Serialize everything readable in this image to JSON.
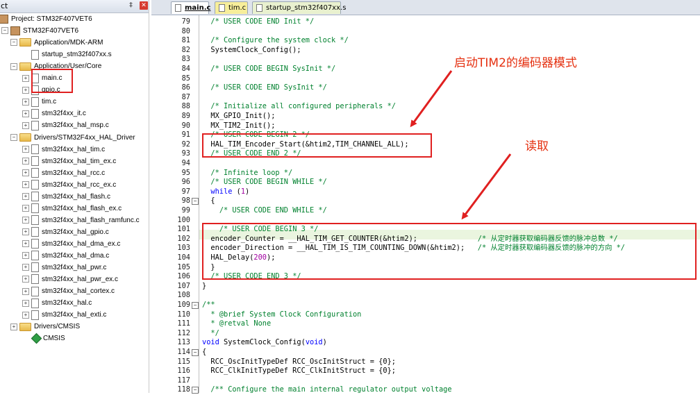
{
  "panel": {
    "title": "ct",
    "pin_glyph": "‡",
    "close_glyph": "✕",
    "tree": [
      {
        "label": "Project: STM32F407VET6",
        "icon": "project-icon",
        "expander": ""
      },
      {
        "label": "STM32F407VET6",
        "icon": "target-icon",
        "expander": "−"
      },
      {
        "label": "Application/MDK-ARM",
        "icon": "folder-icon",
        "expander": "−"
      },
      {
        "label": "startup_stm32f407xx.s",
        "icon": "file-icon",
        "expander": ""
      },
      {
        "label": "Application/User/Core",
        "icon": "folder-icon",
        "expander": "−"
      },
      {
        "label": "main.c",
        "icon": "file-icon",
        "expander": "+"
      },
      {
        "label": "gpio.c",
        "icon": "file-icon",
        "expander": "+"
      },
      {
        "label": "tim.c",
        "icon": "file-icon",
        "expander": "+"
      },
      {
        "label": "stm32f4xx_it.c",
        "icon": "file-icon",
        "expander": "+"
      },
      {
        "label": "stm32f4xx_hal_msp.c",
        "icon": "file-icon",
        "expander": "+"
      },
      {
        "label": "Drivers/STM32F4xx_HAL_Driver",
        "icon": "folder-icon",
        "expander": "−"
      },
      {
        "label": "stm32f4xx_hal_tim.c",
        "icon": "file-icon",
        "expander": "+"
      },
      {
        "label": "stm32f4xx_hal_tim_ex.c",
        "icon": "file-icon",
        "expander": "+"
      },
      {
        "label": "stm32f4xx_hal_rcc.c",
        "icon": "file-icon",
        "expander": "+"
      },
      {
        "label": "stm32f4xx_hal_rcc_ex.c",
        "icon": "file-icon",
        "expander": "+"
      },
      {
        "label": "stm32f4xx_hal_flash.c",
        "icon": "file-icon",
        "expander": "+"
      },
      {
        "label": "stm32f4xx_hal_flash_ex.c",
        "icon": "file-icon",
        "expander": "+"
      },
      {
        "label": "stm32f4xx_hal_flash_ramfunc.c",
        "icon": "file-icon",
        "expander": "+"
      },
      {
        "label": "stm32f4xx_hal_gpio.c",
        "icon": "file-icon",
        "expander": "+"
      },
      {
        "label": "stm32f4xx_hal_dma_ex.c",
        "icon": "file-icon",
        "expander": "+"
      },
      {
        "label": "stm32f4xx_hal_dma.c",
        "icon": "file-icon",
        "expander": "+"
      },
      {
        "label": "stm32f4xx_hal_pwr.c",
        "icon": "file-icon",
        "expander": "+"
      },
      {
        "label": "stm32f4xx_hal_pwr_ex.c",
        "icon": "file-icon",
        "expander": "+"
      },
      {
        "label": "stm32f4xx_hal_cortex.c",
        "icon": "file-icon",
        "expander": "+"
      },
      {
        "label": "stm32f4xx_hal.c",
        "icon": "file-icon",
        "expander": "+"
      },
      {
        "label": "stm32f4xx_hal_exti.c",
        "icon": "file-icon",
        "expander": "+"
      },
      {
        "label": "Drivers/CMSIS",
        "icon": "folder-icon",
        "expander": "+"
      },
      {
        "label": "CMSIS",
        "icon": "green-gem-icon",
        "expander": ""
      }
    ]
  },
  "tabs": [
    {
      "label": "main.c",
      "active": true
    },
    {
      "label": "tim.c",
      "active": false
    },
    {
      "label": "startup_stm32f407xx.s",
      "active": false
    }
  ],
  "code_lines": [
    {
      "n": "79",
      "fold": "",
      "text": "  /* USER CODE END Init */"
    },
    {
      "n": "80",
      "fold": "",
      "text": ""
    },
    {
      "n": "81",
      "fold": "",
      "text": "  /* Configure the system clock */"
    },
    {
      "n": "82",
      "fold": "",
      "text": "  SystemClock_Config();"
    },
    {
      "n": "83",
      "fold": "",
      "text": ""
    },
    {
      "n": "84",
      "fold": "",
      "text": "  /* USER CODE BEGIN SysInit */"
    },
    {
      "n": "85",
      "fold": "",
      "text": ""
    },
    {
      "n": "86",
      "fold": "",
      "text": "  /* USER CODE END SysInit */"
    },
    {
      "n": "87",
      "fold": "",
      "text": ""
    },
    {
      "n": "88",
      "fold": "",
      "text": "  /* Initialize all configured peripherals */"
    },
    {
      "n": "89",
      "fold": "",
      "text": "  MX_GPIO_Init();"
    },
    {
      "n": "90",
      "fold": "",
      "text": "  MX_TIM2_Init();"
    },
    {
      "n": "91",
      "fold": "",
      "text": "  /* USER CODE BEGIN 2 */"
    },
    {
      "n": "92",
      "fold": "",
      "text": "  HAL_TIM_Encoder_Start(&htim2,TIM_CHANNEL_ALL);"
    },
    {
      "n": "93",
      "fold": "",
      "text": "  /* USER CODE END 2 */"
    },
    {
      "n": "94",
      "fold": "",
      "text": ""
    },
    {
      "n": "95",
      "fold": "",
      "text": "  /* Infinite loop */"
    },
    {
      "n": "96",
      "fold": "",
      "text": "  /* USER CODE BEGIN WHILE */"
    },
    {
      "n": "97",
      "fold": "",
      "text": "  while (1)"
    },
    {
      "n": "98",
      "fold": "−",
      "text": "  {"
    },
    {
      "n": "99",
      "fold": "",
      "text": "    /* USER CODE END WHILE */"
    },
    {
      "n": "100",
      "fold": "",
      "text": ""
    },
    {
      "n": "101",
      "fold": "",
      "text": "    /* USER CODE BEGIN 3 */"
    },
    {
      "n": "102",
      "fold": "",
      "text": "  encoder_Counter = __HAL_TIM_GET_COUNTER(&htim2);              /* 从定时器获取编码器反馈的脉冲总数 */"
    },
    {
      "n": "103",
      "fold": "",
      "text": "  encoder_Direction = __HAL_TIM_IS_TIM_COUNTING_DOWN(&htim2);   /* 从定时器获取编码器反馈的脉冲的方向 */"
    },
    {
      "n": "104",
      "fold": "",
      "text": "  HAL_Delay(200);"
    },
    {
      "n": "105",
      "fold": "",
      "text": "  }"
    },
    {
      "n": "106",
      "fold": "",
      "text": "  /* USER CODE END 3 */"
    },
    {
      "n": "107",
      "fold": "",
      "text": "}"
    },
    {
      "n": "108",
      "fold": "",
      "text": ""
    },
    {
      "n": "109",
      "fold": "−",
      "text": "/**"
    },
    {
      "n": "110",
      "fold": "",
      "text": "  * @brief System Clock Configuration"
    },
    {
      "n": "111",
      "fold": "",
      "text": "  * @retval None"
    },
    {
      "n": "112",
      "fold": "",
      "text": "  */"
    },
    {
      "n": "113",
      "fold": "",
      "text": "void SystemClock_Config(void)"
    },
    {
      "n": "114",
      "fold": "−",
      "text": "{"
    },
    {
      "n": "115",
      "fold": "",
      "text": "  RCC_OscInitTypeDef RCC_OscInitStruct = {0};"
    },
    {
      "n": "116",
      "fold": "",
      "text": "  RCC_ClkInitTypeDef RCC_ClkInitStruct = {0};"
    },
    {
      "n": "117",
      "fold": "",
      "text": ""
    },
    {
      "n": "118",
      "fold": "−",
      "text": "  /** Configure the main internal regulator output voltage"
    }
  ],
  "annotations": {
    "encoder_mode": "启动TIM2的编码器模式",
    "read": "读取"
  },
  "colors": {
    "comment": "#00812e",
    "keyword": "#0000ff",
    "annotation_red": "#e02020"
  }
}
